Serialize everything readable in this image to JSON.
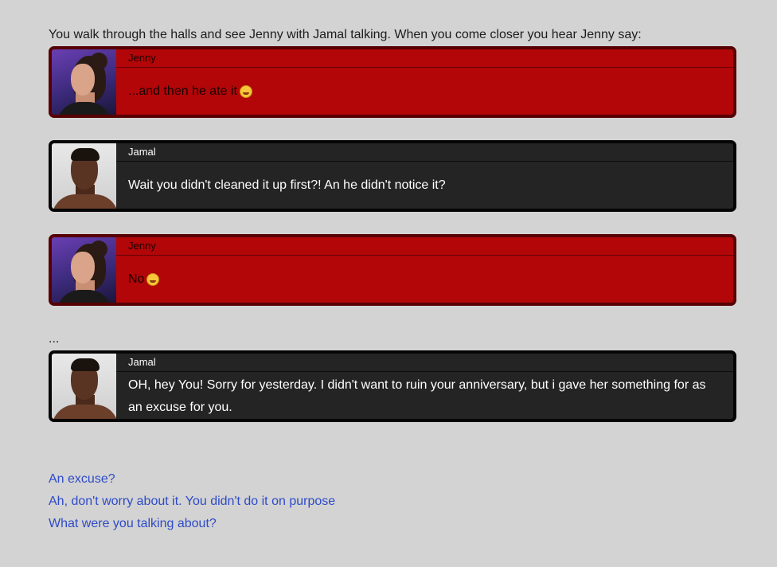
{
  "intro": "You walk through the halls and see Jenny with Jamal talking. When you come closer you hear Jenny say:",
  "messages": [
    {
      "speaker": "Jenny",
      "text": "...and then he ate it",
      "emoji": "grinning-sweat-emoji"
    },
    {
      "speaker": "Jamal",
      "text": "Wait you didn't cleaned it up first?! An he didn't notice it?"
    },
    {
      "speaker": "Jenny",
      "text": "No",
      "emoji": "smirk-emoji"
    },
    {
      "speaker": "Jamal",
      "text": "OH, hey You! Sorry for yesterday. I didn't want to ruin your anniversary, but i gave her something for as an excuse for you."
    }
  ],
  "ellipsis": "...",
  "choices": [
    "An excuse?",
    "Ah, don't worry about it. You didn't do it on purpose",
    "What were you talking about?"
  ],
  "colors": {
    "jenny_bg": "#b20608",
    "jamal_bg": "#242424",
    "link": "#2e4bc8",
    "page_bg": "#d3d3d3"
  }
}
